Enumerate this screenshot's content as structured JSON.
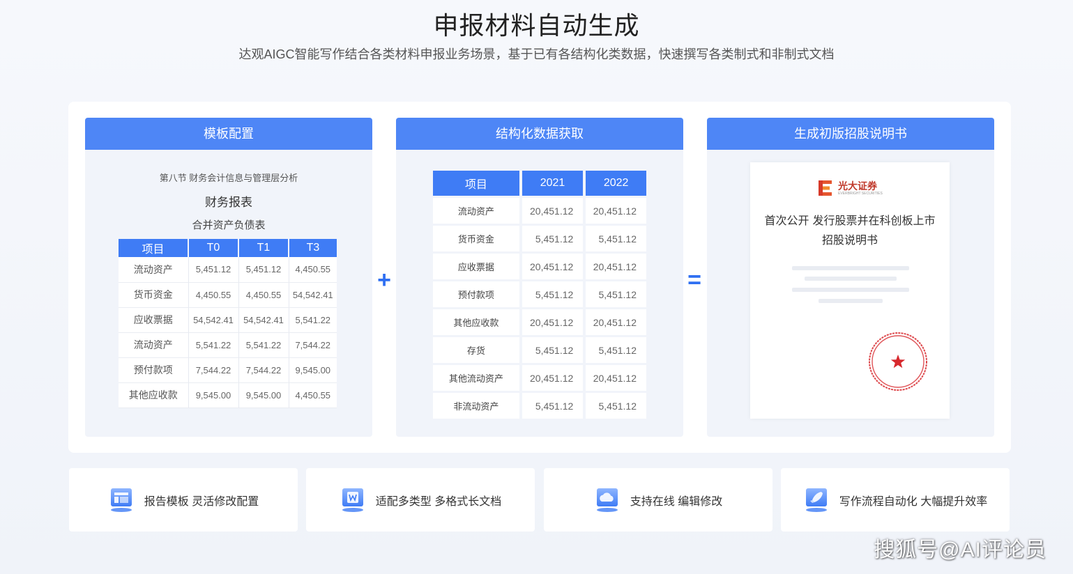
{
  "header": {
    "title": "申报材料自动生成",
    "subtitle": "达观AIGC智能写作结合各类材料申报业务场景，基于已有各结构化类数据，快速撰写各类制式和非制式文档"
  },
  "cards": {
    "template": {
      "header": "模板配置",
      "section": "第八节 财务会计信息与管理层分析",
      "title": "财务报表",
      "subtitle": "合并资产负债表",
      "columns": [
        "项目",
        "T0",
        "T1",
        "T3"
      ],
      "rows": [
        [
          "流动资产",
          "5,451.12",
          "5,451.12",
          "4,450.55"
        ],
        [
          "货币资金",
          "4,450.55",
          "4,450.55",
          "54,542.41"
        ],
        [
          "应收票据",
          "54,542.41",
          "54,542.41",
          "5,541.22"
        ],
        [
          "流动资产",
          "5,541.22",
          "5,541.22",
          "7,544.22"
        ],
        [
          "预付款项",
          "7,544.22",
          "7,544.22",
          "9,545.00"
        ],
        [
          "其他应收款",
          "9,545.00",
          "9,545.00",
          "4,450.55"
        ]
      ]
    },
    "data": {
      "header": "结构化数据获取",
      "columns": [
        "项目",
        "2021",
        "2022"
      ],
      "rows": [
        [
          "流动资产",
          "20,451.12",
          "20,451.12"
        ],
        [
          "货币资金",
          "5,451.12",
          "5,451.12"
        ],
        [
          "应收票据",
          "20,451.12",
          "20,451.12"
        ],
        [
          "预付款项",
          "5,451.12",
          "5,451.12"
        ],
        [
          "其他应收款",
          "20,451.12",
          "20,451.12"
        ],
        [
          "存货",
          "5,451.12",
          "5,451.12"
        ],
        [
          "其他流动资产",
          "20,451.12",
          "20,451.12"
        ],
        [
          "非流动资产",
          "5,451.12",
          "5,451.12"
        ]
      ]
    },
    "output": {
      "header": "生成初版招股说明书",
      "brand_name": "光大证券",
      "brand_en": "EVERBRIGHT SECURITIES",
      "doc_title_line1": "首次公开 发行股票并在科创板上市",
      "doc_title_line2": "招股说明书"
    }
  },
  "operators": {
    "plus": "+",
    "equals": "="
  },
  "features": [
    {
      "label": "报告模板 灵活修改配置",
      "icon": "template-icon"
    },
    {
      "label": "适配多类型 多格式长文档",
      "icon": "document-format-icon"
    },
    {
      "label": "支持在线 编辑修改",
      "icon": "cloud-edit-icon"
    },
    {
      "label": "写作流程自动化 大幅提升效率",
      "icon": "rocket-icon"
    }
  ],
  "watermark": "搜狐号@AI评论员",
  "colors": {
    "accent": "#4e86f6",
    "table_header": "#3f7cf5",
    "seal": "#d7282d",
    "brand": "#c0392b"
  }
}
